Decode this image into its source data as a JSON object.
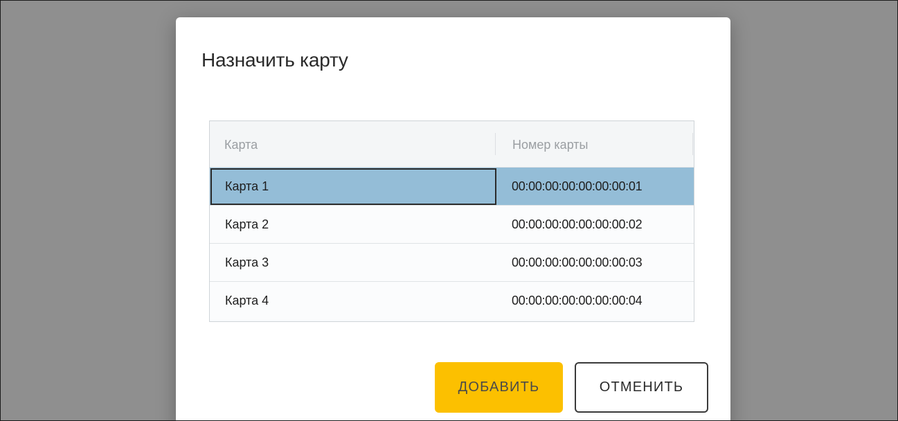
{
  "dialog": {
    "title": "Назначить карту"
  },
  "table": {
    "columns": [
      "Карта",
      "Номер карты"
    ],
    "rows": [
      {
        "name": "Карта 1",
        "number": "00:00:00:00:00:00:00:01",
        "selected": true
      },
      {
        "name": "Карта 2",
        "number": "00:00:00:00:00:00:00:02",
        "selected": false
      },
      {
        "name": "Карта 3",
        "number": "00:00:00:00:00:00:00:03",
        "selected": false
      },
      {
        "name": "Карта 4",
        "number": "00:00:00:00:00:00:00:04",
        "selected": false
      }
    ]
  },
  "buttons": {
    "add_label": "ДОБАВИТЬ",
    "cancel_label": "ОТМЕНИТЬ"
  },
  "colors": {
    "overlay": "#8f8f8f",
    "selected_row": "#94bdd7",
    "primary_button": "#fcc000"
  }
}
